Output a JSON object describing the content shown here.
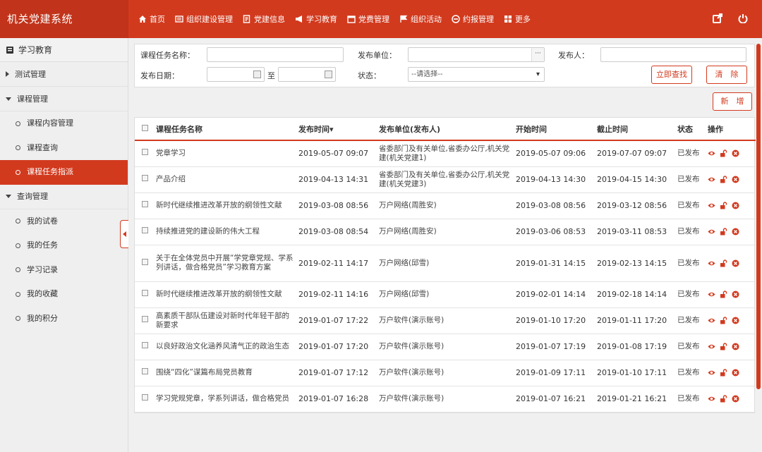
{
  "app_title": "机关党建系统",
  "nav": [
    {
      "label": "首页",
      "icon": "home-icon"
    },
    {
      "label": "组织建设管理",
      "icon": "org-icon"
    },
    {
      "label": "党建信息",
      "icon": "info-icon"
    },
    {
      "label": "学习教育",
      "icon": "megaphone-icon"
    },
    {
      "label": "党费管理",
      "icon": "calendar-icon"
    },
    {
      "label": "组织活动",
      "icon": "flag-icon"
    },
    {
      "label": "约报管理",
      "icon": "minus-circle-icon"
    },
    {
      "label": "更多",
      "icon": "grid-icon"
    }
  ],
  "sidebar": {
    "title": "学习教育",
    "groups": [
      {
        "label": "测试管理",
        "expanded": false,
        "items": []
      },
      {
        "label": "课程管理",
        "expanded": true,
        "items": [
          "课程内容管理",
          "课程查询",
          "课程任务指派"
        ]
      },
      {
        "label": "查询管理",
        "expanded": true,
        "items": [
          "我的试卷",
          "我的任务",
          "学习记录",
          "我的收藏",
          "我的积分"
        ]
      }
    ],
    "active_item": "课程任务指派"
  },
  "search": {
    "task_name_label": "课程任务名称：",
    "unit_label": "发布单位：",
    "unit_dots": "···",
    "publisher_label": "发布人：",
    "date_label": "发布日期：",
    "to_label": "至",
    "status_label": "状态：",
    "status_placeholder": "--请选择--",
    "search_button": "立即查找",
    "clear_button": "清　除",
    "add_button": "新　增"
  },
  "table": {
    "headers": [
      "课程任务名称",
      "发布时间▾",
      "发布单位(发布人)",
      "开始时间",
      "截止时间",
      "状态",
      "操作"
    ],
    "rows": [
      {
        "name": "党章学习",
        "pub": "2019-05-07 09:07",
        "unit": "省委部门及有关单位,省委办公厅,机关党建(机关党建1)",
        "start": "2019-05-07 09:06",
        "end": "2019-07-07 09:07",
        "status": "已发布"
      },
      {
        "name": "产品介绍",
        "pub": "2019-04-13 14:31",
        "unit": "省委部门及有关单位,省委办公厅,机关党建(机关党建3)",
        "start": "2019-04-13 14:30",
        "end": "2019-04-15 14:30",
        "status": "已发布"
      },
      {
        "name": "新时代继续推进改革开放的纲领性文献",
        "pub": "2019-03-08 08:56",
        "unit": "万户网络(周胜安)",
        "start": "2019-03-08 08:56",
        "end": "2019-03-12 08:56",
        "status": "已发布"
      },
      {
        "name": "持续推进党的建设新的伟大工程",
        "pub": "2019-03-08 08:54",
        "unit": "万户网络(周胜安)",
        "start": "2019-03-06 08:53",
        "end": "2019-03-11 08:53",
        "status": "已发布"
      },
      {
        "name": "关于在全体党员中开展“学党章党规、学系列讲话，做合格党员”学习教育方案",
        "pub": "2019-02-11 14:17",
        "unit": "万户网络(邱雪)",
        "start": "2019-01-31 14:15",
        "end": "2019-02-13 14:15",
        "status": "已发布"
      },
      {
        "name": "新时代继续推进改革开放的纲领性文献",
        "pub": "2019-02-11 14:16",
        "unit": "万户网络(邱雪)",
        "start": "2019-02-01 14:14",
        "end": "2019-02-18 14:14",
        "status": "已发布"
      },
      {
        "name": "高素质干部队伍建设对新时代年轻干部的新要求",
        "pub": "2019-01-07 17:22",
        "unit": "万户软件(演示账号)",
        "start": "2019-01-10 17:20",
        "end": "2019-01-11 17:20",
        "status": "已发布"
      },
      {
        "name": "以良好政治文化涵养风清气正的政治生态",
        "pub": "2019-01-07 17:20",
        "unit": "万户软件(演示账号)",
        "start": "2019-01-07 17:19",
        "end": "2019-01-08 17:19",
        "status": "已发布"
      },
      {
        "name": "围绕“四化”谋篇布局党员教育",
        "pub": "2019-01-07 17:12",
        "unit": "万户软件(演示账号)",
        "start": "2019-01-09 17:11",
        "end": "2019-01-10 17:11",
        "status": "已发布"
      },
      {
        "name": "学习党规党章，学系列讲话，做合格党员",
        "pub": "2019-01-07 16:28",
        "unit": "万户软件(演示账号)",
        "start": "2019-01-07 16:21",
        "end": "2019-01-21 16:21",
        "status": "已发布"
      }
    ]
  },
  "colors": {
    "accent": "#d23a1e",
    "brand_bg": "#c1331a"
  }
}
